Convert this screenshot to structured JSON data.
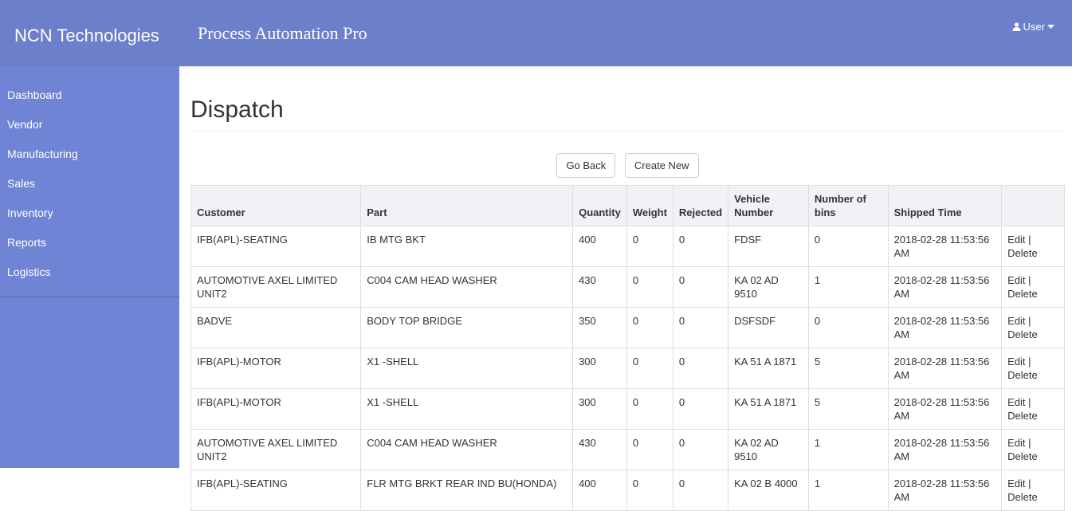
{
  "header": {
    "brand": "NCN Technologies",
    "app_title": "Process Automation Pro",
    "user_label": "User"
  },
  "sidebar": {
    "items": [
      {
        "label": "Dashboard"
      },
      {
        "label": "Vendor"
      },
      {
        "label": "Manufacturing"
      },
      {
        "label": "Sales"
      },
      {
        "label": "Inventory"
      },
      {
        "label": "Reports"
      },
      {
        "label": "Logistics"
      }
    ]
  },
  "main": {
    "title": "Dispatch",
    "go_back": "Go Back",
    "create_new": "Create New",
    "columns": [
      "Customer",
      "Part",
      "Quantity",
      "Weight",
      "Rejected",
      "Vehicle Number",
      "Number of bins",
      "Shipped Time",
      ""
    ],
    "rows": [
      [
        "IFB(APL)-SEATING",
        "IB MTG BKT",
        "400",
        "0",
        "0",
        "FDSF",
        "0",
        "2018-02-28 11:53:56 AM"
      ],
      [
        "AUTOMOTIVE AXEL LIMITED UNIT2",
        "C004 CAM HEAD WASHER",
        "430",
        "0",
        "0",
        "KA 02 AD 9510",
        "1",
        "2018-02-28 11:53:56 AM"
      ],
      [
        "BADVE",
        "BODY TOP BRIDGE",
        "350",
        "0",
        "0",
        "DSFSDF",
        "0",
        "2018-02-28 11:53:56 AM"
      ],
      [
        "IFB(APL)-MOTOR",
        "X1 -SHELL",
        "300",
        "0",
        "0",
        "KA 51 A 1871",
        "5",
        "2018-02-28 11:53:56 AM"
      ],
      [
        "IFB(APL)-MOTOR",
        "X1 -SHELL",
        "300",
        "0",
        "0",
        "KA 51 A 1871",
        "5",
        "2018-02-28 11:53:56 AM"
      ],
      [
        "AUTOMOTIVE AXEL LIMITED UNIT2",
        "C004 CAM HEAD WASHER",
        "430",
        "0",
        "0",
        "KA 02 AD 9510",
        "1",
        "2018-02-28 11:53:56 AM"
      ],
      [
        "IFB(APL)-SEATING",
        "FLR MTG BRKT REAR IND BU(HONDA)",
        "400",
        "0",
        "0",
        "KA 02 B 4000",
        "1",
        "2018-02-28 11:53:56 AM"
      ]
    ],
    "edit_label": "Edit",
    "delete_label": "Delete"
  }
}
